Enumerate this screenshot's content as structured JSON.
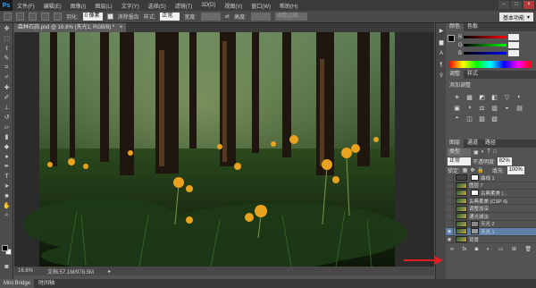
{
  "menubar": {
    "logo": "Ps",
    "items": [
      "文件(F)",
      "编辑(E)",
      "图像(I)",
      "图层(L)",
      "文字(Y)",
      "选择(S)",
      "滤镜(T)",
      "3D(D)",
      "视图(V)",
      "窗口(W)",
      "帮助(H)"
    ],
    "minimize": "–",
    "maximize": "□",
    "close": "×"
  },
  "options": {
    "feather_label": "羽化:",
    "feather_value": "0 像素",
    "antialias_label": "消除锯齿",
    "style_label": "样式:",
    "style_value": "正常",
    "width_label": "宽度:",
    "height_label": "高度:",
    "refine_edge": "调整边缘...",
    "workspace": "基本功能"
  },
  "document": {
    "tab_title": "森林石蒜.psd @ 16.6% (天光1, RGB/8) *",
    "tab_close": "×",
    "zoom": "16.6%",
    "doc_size": "文档:57.1M/978.5M"
  },
  "bottom_tabs": [
    "Mini Bridge",
    "时间轴"
  ],
  "color_panel": {
    "tabs": [
      "颜色",
      "色板"
    ],
    "channels": [
      "R",
      "G",
      "B"
    ]
  },
  "adjust_panel": {
    "tabs": [
      "调整",
      "样式"
    ],
    "title": "添加调整",
    "icons": [
      "☀",
      "▦",
      "◩",
      "◧",
      "▽",
      "◐",
      "▣",
      "◑",
      "⚖",
      "▥",
      "◒",
      "▤",
      "◓",
      "◫",
      "▨",
      "▧"
    ]
  },
  "layers_panel": {
    "tabs": [
      "图层",
      "通道",
      "路径"
    ],
    "filter_label": "类型",
    "blend_mode": "正常",
    "opacity_label": "不透明度:",
    "opacity_value": "82%",
    "lock_label": "锁定:",
    "fill_label": "填充:",
    "fill_value": "100%",
    "layers": [
      {
        "name": "曲线 1",
        "visible": false,
        "kind": "adj",
        "selected": false
      },
      {
        "name": "图层 7",
        "visible": false,
        "kind": "image",
        "selected": false
      },
      {
        "name": "古典柔美 (...",
        "visible": false,
        "kind": "image",
        "selected": false
      },
      {
        "name": "古典柔美 (CSP 4)",
        "visible": false,
        "kind": "image",
        "selected": false
      },
      {
        "name": "调整加深",
        "visible": false,
        "kind": "image",
        "selected": false
      },
      {
        "name": "通光减淡",
        "visible": false,
        "kind": "image",
        "selected": false
      },
      {
        "name": "天光 2",
        "visible": false,
        "kind": "image",
        "selected": false
      },
      {
        "name": "天光 1",
        "visible": true,
        "kind": "image",
        "selected": true
      },
      {
        "name": "背景",
        "visible": true,
        "kind": "image",
        "selected": false
      }
    ]
  },
  "colors": {
    "accent_selection": "#5d7fa8",
    "annotation_arrow": "#e02020",
    "flower": "#e8a21e"
  }
}
